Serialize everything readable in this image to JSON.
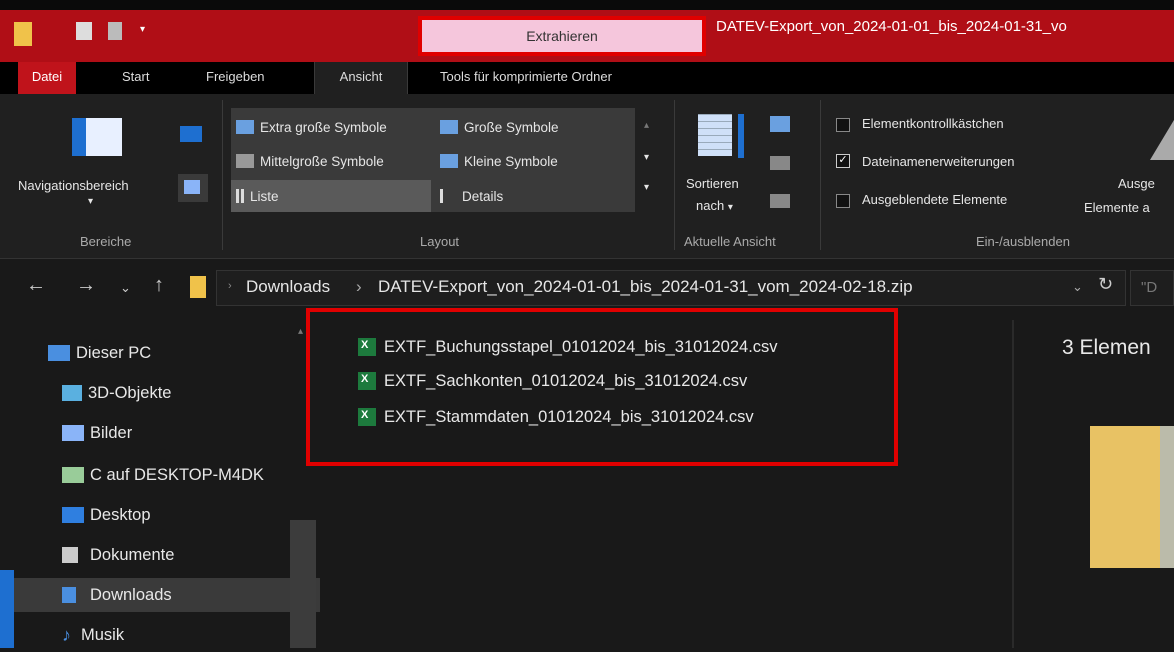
{
  "titlebar": {
    "active_context_tab": "Extrahieren",
    "window_title": "DATEV-Export_von_2024-01-01_bis_2024-01-31_vo"
  },
  "tabs": [
    "Datei",
    "Start",
    "Freigeben",
    "Ansicht",
    "Tools für komprimierte Ordner"
  ],
  "ribbon": {
    "bereiche": {
      "nav_pane_label": "Navigationsbereich",
      "group_label": "Bereiche"
    },
    "layout": {
      "items": [
        "Extra große Symbole",
        "Große Symbole",
        "Mittelgroße Symbole",
        "Kleine Symbole",
        "Liste",
        "Details"
      ],
      "group_label": "Layout"
    },
    "aktuelle_ansicht": {
      "sort_label1": "Sortieren",
      "sort_label2": "nach",
      "group_label": "Aktuelle Ansicht"
    },
    "ein_ausblenden": {
      "options": [
        {
          "label": "Elementkontrollkästchen",
          "checked": false
        },
        {
          "label": "Dateinamenerweiterungen",
          "checked": true
        },
        {
          "label": "Ausgeblendete Elemente",
          "checked": false
        }
      ],
      "partial_button_line1": "Ausge",
      "partial_button_line2": "Elemente a",
      "group_label": "Ein-/ausblenden"
    }
  },
  "address": {
    "crumbs": [
      "Downloads",
      "DATEV-Export_von_2024-01-01_bis_2024-01-31_vom_2024-02-18.zip"
    ],
    "search_placeholder": "\"D"
  },
  "sidebar": {
    "items": [
      "Dieser PC",
      "3D-Objekte",
      "Bilder",
      "C auf DESKTOP-M4DK",
      "Desktop",
      "Dokumente",
      "Downloads",
      "Musik"
    ]
  },
  "files": [
    "EXTF_Buchungsstapel_01012024_bis_31012024.csv",
    "EXTF_Sachkonten_01012024_bis_31012024.csv",
    "EXTF_Stammdaten_01012024_bis_31012024.csv"
  ],
  "preview": {
    "count_text": "3 Elemen"
  },
  "colors": {
    "accent_red": "#b00e16",
    "highlight_border": "#e00000",
    "context_tab": "#f5c6dc"
  }
}
